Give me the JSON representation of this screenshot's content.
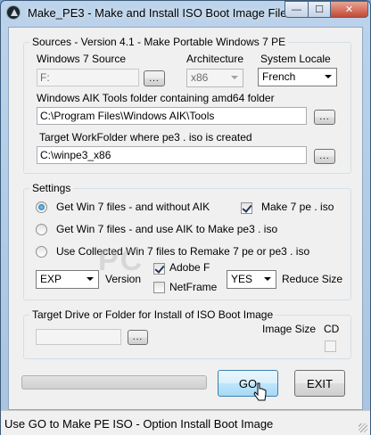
{
  "window": {
    "title": "Make_PE3 - Make and Install ISO Boot Image File",
    "min_symbol": "—",
    "max_symbol": "☐",
    "close_symbol": "✕"
  },
  "sources": {
    "legend": "Sources - Version 4.1 - Make Portable Windows 7 PE",
    "win7_source_label": "Windows 7  Source",
    "win7_source_value": "F:",
    "architecture_label": "Architecture",
    "architecture_value": "x86",
    "locale_label": "System Locale",
    "locale_value": "French",
    "aik_label": "Windows AIK Tools folder containing  amd64  folder",
    "aik_value": "C:\\Program Files\\Windows AIK\\Tools",
    "workfolder_label": "Target WorkFolder where pe3 . iso is created",
    "workfolder_value": "C:\\winpe3_x86",
    "browse_label": "..."
  },
  "settings": {
    "legend": "Settings",
    "option1": "Get Win 7 files  -  and  without  AIK",
    "option2": "Get Win 7 files  -  and  use  AIK to  Make  pe3 . iso",
    "option3": "Use Collected Win 7 files  to  Remake  7 pe or pe3 . iso",
    "make7pe_label": "Make 7 pe . iso",
    "version_value": "EXP",
    "version_label": "Version",
    "adobe_label": "Adobe F",
    "netframe_label": "NetFrame",
    "reduce_value": "YES",
    "reduce_label": "Reduce Size"
  },
  "target": {
    "legend": "Target Drive or Folder for Install of ISO Boot Image",
    "drive_value": "",
    "browse_label": "...",
    "image_size_label": "Image Size",
    "cd_label": "CD"
  },
  "actions": {
    "go_label": "GO",
    "exit_label": "EXIT"
  },
  "status": {
    "text": "Use GO to Make PE  ISO - Option Install Boot Image"
  },
  "icons": {
    "app": "app-triangle-icon",
    "cursor": "mouse-pointer-icon"
  }
}
